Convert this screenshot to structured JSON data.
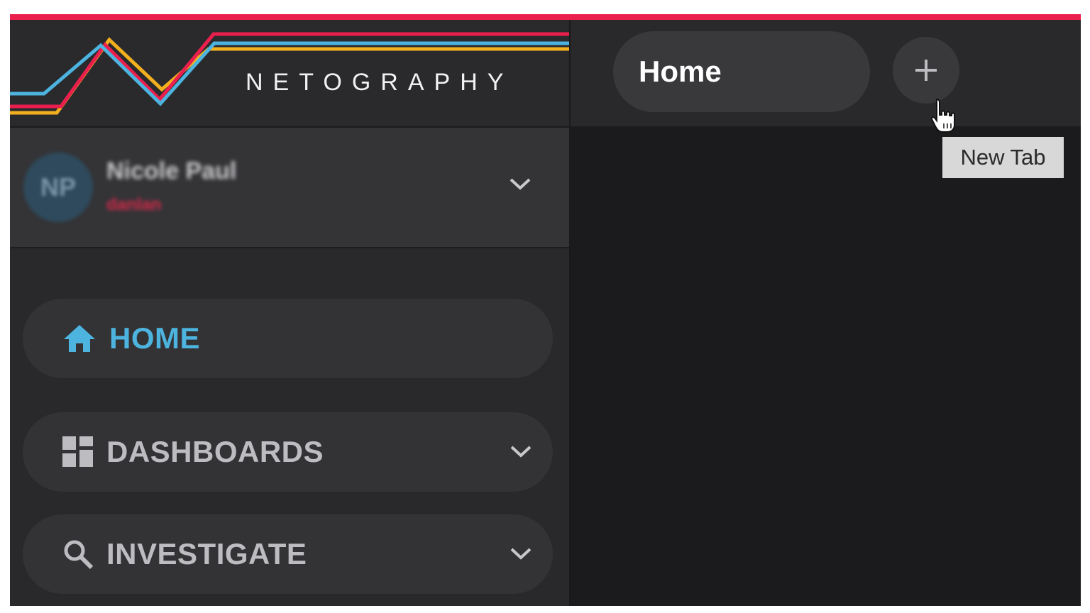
{
  "brand": {
    "name": "NETOGRAPHY",
    "colors": {
      "red": "#ea1f4d",
      "yellow": "#f2b01e",
      "blue": "#4cb4de"
    }
  },
  "user": {
    "initials": "NP",
    "name": "Nicole Paul",
    "role": "danlan"
  },
  "sidebar": {
    "items": [
      {
        "label": "HOME",
        "icon": "home-icon",
        "active": true
      },
      {
        "label": "DASHBOARDS",
        "icon": "grid-icon",
        "active": false,
        "expandable": true
      },
      {
        "label": "INVESTIGATE",
        "icon": "search-icon",
        "active": false,
        "expandable": true
      }
    ]
  },
  "tabs": {
    "items": [
      {
        "label": "Home"
      }
    ],
    "new_tab_tooltip": "New Tab"
  }
}
